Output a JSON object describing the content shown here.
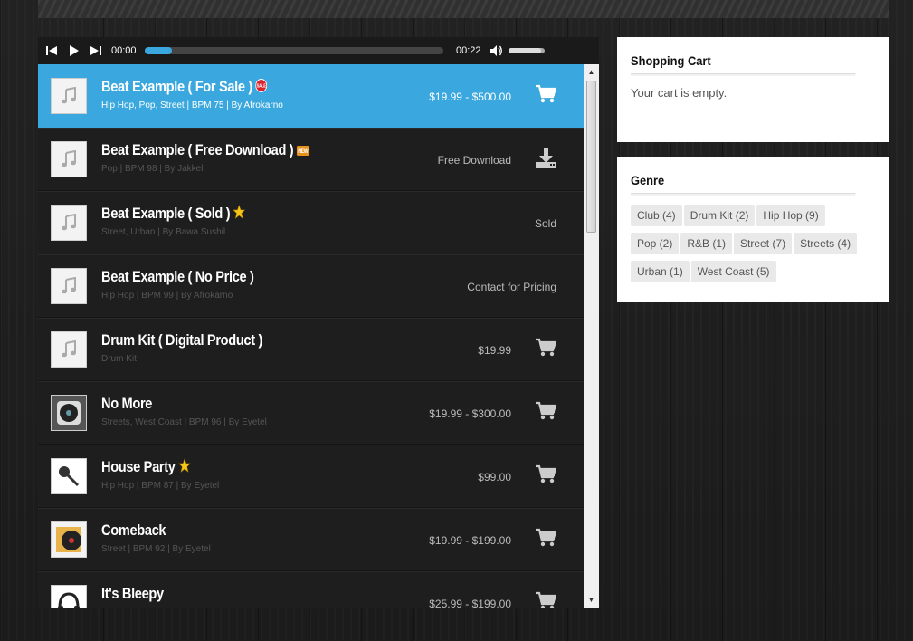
{
  "player": {
    "time_current": "00:00",
    "time_total": "00:22",
    "progress": 0.09,
    "volume": 0.9
  },
  "tracks": [
    {
      "title": "Beat Example ( For Sale )",
      "badge": "sale",
      "meta": "Hip Hop, Pop, Street | BPM 75 | By Afrokarno",
      "price": "$19.99 - $500.00",
      "action": "cart",
      "thumb": "music-note"
    },
    {
      "title": "Beat Example ( Free Download )",
      "badge": "new",
      "meta": "Pop | BPM 98 | By Jakkel",
      "price": "Free Download",
      "action": "download",
      "thumb": "music-note"
    },
    {
      "title": "Beat Example ( Sold )",
      "badge": "star",
      "meta": "Street, Urban | By Bawa Sushil",
      "price": "Sold",
      "action": "",
      "thumb": "music-note"
    },
    {
      "title": "Beat Example ( No Price )",
      "badge": "",
      "meta": "Hip Hop | BPM 99 | By Afrokarno",
      "price": "Contact for Pricing",
      "action": "",
      "thumb": "music-note"
    },
    {
      "title": "Drum Kit ( Digital Product )",
      "badge": "",
      "meta": "Drum Kit",
      "price": "$19.99",
      "action": "cart",
      "thumb": "music-note"
    },
    {
      "title": "No More",
      "badge": "",
      "meta": "Streets, West Coast | BPM 96 | By Eyetel",
      "price": "$19.99 - $300.00",
      "action": "cart",
      "thumb": "turntable"
    },
    {
      "title": "House Party",
      "badge": "star",
      "meta": "Hip Hop | BPM 87 | By Eyetel",
      "price": "$99.00",
      "action": "cart",
      "thumb": "microphone"
    },
    {
      "title": "Comeback",
      "badge": "",
      "meta": "Street | BPM 92 | By Eyetel",
      "price": "$19.99 - $199.00",
      "action": "cart",
      "thumb": "vinyl"
    },
    {
      "title": "It's Bleepy",
      "badge": "",
      "meta": "",
      "price": "$25.99 - $199.00",
      "action": "cart",
      "thumb": "headphones"
    }
  ],
  "cart": {
    "title": "Shopping Cart",
    "empty_text": "Your cart is empty."
  },
  "genre": {
    "title": "Genre",
    "tags": [
      "Club (4)",
      "Drum Kit (2)",
      "Hip Hop (9)",
      "Pop (2)",
      "R&B (1)",
      "Street (7)",
      "Streets (4)",
      "Urban (1)",
      "West Coast (5)"
    ]
  },
  "colors": {
    "accent": "#3aa8de",
    "row_bg": "#1e1e1e"
  }
}
